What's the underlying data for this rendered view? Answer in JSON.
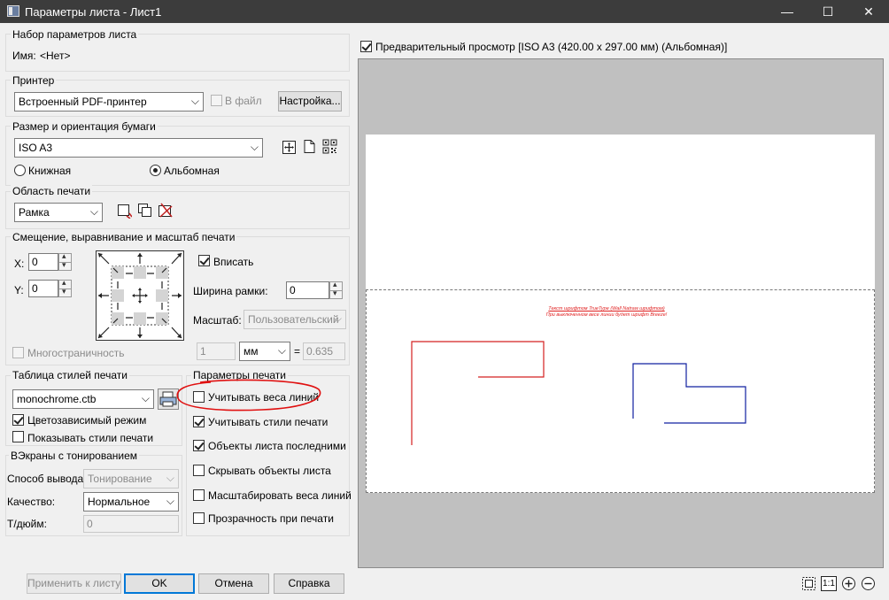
{
  "window": {
    "title": "Параметры листа - Лист1",
    "controls": {
      "minimize": "—",
      "maximize": "☐",
      "close": "✕"
    }
  },
  "page_setup": {
    "group_title": "Набор параметров листа",
    "name_label": "Имя:",
    "name_value": "<Нет>"
  },
  "printer": {
    "group_title": "Принтер",
    "selected": "Встроенный PDF-принтер",
    "to_file_label": "В файл",
    "settings_button": "Настройка..."
  },
  "paper": {
    "group_title": "Размер и ориентация бумаги",
    "size": "ISO A3",
    "portrait_label": "Книжная",
    "landscape_label": "Альбомная",
    "orientation": "landscape"
  },
  "print_area": {
    "group_title": "Область печати",
    "selected": "Рамка"
  },
  "offset": {
    "group_title": "Смещение, выравнивание и масштаб печати",
    "x_label": "X:",
    "x_value": "0",
    "y_label": "Y:",
    "y_value": "0",
    "fit_label": "Вписать",
    "frame_width_label": "Ширина рамки:",
    "frame_width_value": "0",
    "scale_label": "Масштаб:",
    "scale_value": "Пользовательский",
    "scale_num": "1",
    "scale_unit": "мм",
    "equals": "=",
    "scale_den": "0.635",
    "multipage_label": "Многостраничность"
  },
  "plot_style": {
    "group_title": "Таблица стилей печати",
    "selected": "monochrome.ctb",
    "color_dependent_label": "Цветозависимый режим",
    "show_styles_label": "Показывать стили печати"
  },
  "shaded": {
    "group_title": "ВЭкраны с тонированием",
    "output_label": "Способ вывода:",
    "output_value": "Тонирование",
    "quality_label": "Качество:",
    "quality_value": "Нормальное",
    "dpi_label": "Т/дюйм:",
    "dpi_value": "0"
  },
  "plot_options": {
    "group_title": "Параметры печати",
    "items": [
      {
        "label": "Учитывать веса линий",
        "checked": false
      },
      {
        "label": "Учитывать стили печати",
        "checked": true
      },
      {
        "label": "Объекты листа последними",
        "checked": true
      },
      {
        "label": "Скрывать объекты листа",
        "checked": false
      },
      {
        "label": "Масштабировать веса линий",
        "checked": false
      },
      {
        "label": "Прозрачность при печати",
        "checked": false
      }
    ]
  },
  "preview": {
    "checkbox_label": "Предварительный просмотр [ISO A3 (420.00 x 297.00 мм) (Альбомная)]",
    "red_text_line1": "Текст шрифтом TrueType (Wall Natraw шрифтом)",
    "red_text_line2": "При выключенном весе линии будет шрифт Breeze!",
    "zoom_one_to_one": "1:1"
  },
  "buttons": {
    "apply": "Применить к листу",
    "ok": "OK",
    "cancel": "Отмена",
    "help": "Справка"
  },
  "colors": {
    "titlebar": "#3c3c3c",
    "accent": "#0078d7",
    "annotation": "#e02020",
    "red_lines": "#d42020",
    "blue_lines": "#1020a0"
  }
}
